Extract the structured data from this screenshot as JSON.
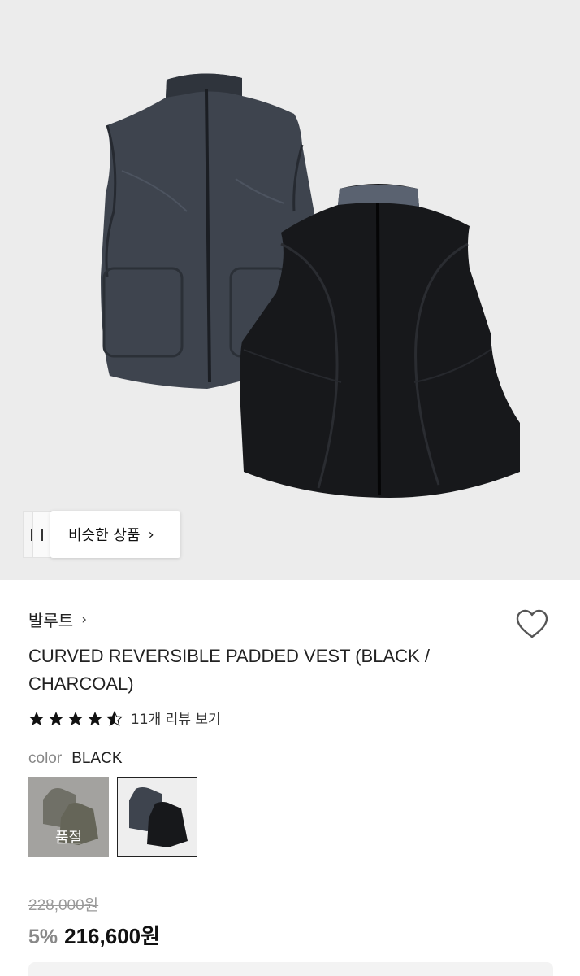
{
  "similar": {
    "label": "비슷한 상품",
    "chevron": "›"
  },
  "product": {
    "brand": "발루트",
    "brand_chevron": "›",
    "title": "CURVED REVERSIBLE PADDED VEST (BLACK / CHARCOAL)",
    "rating": 4.5,
    "review_link": "11개 리뷰 보기",
    "color_label": "color",
    "color_value": "BLACK",
    "swatches": [
      {
        "name": "khaki",
        "sold_out_label": "품절",
        "sold_out": true
      },
      {
        "name": "black",
        "selected": true
      }
    ],
    "original_price": "228,000원",
    "discount": "5%",
    "price": "216,600원"
  },
  "icons": {
    "wishlist": "heart-outline-icon",
    "star": "star-icon"
  },
  "colors": {
    "background": "#ececec",
    "charcoal_vest": "#3e444e",
    "black_vest": "#17181b"
  }
}
